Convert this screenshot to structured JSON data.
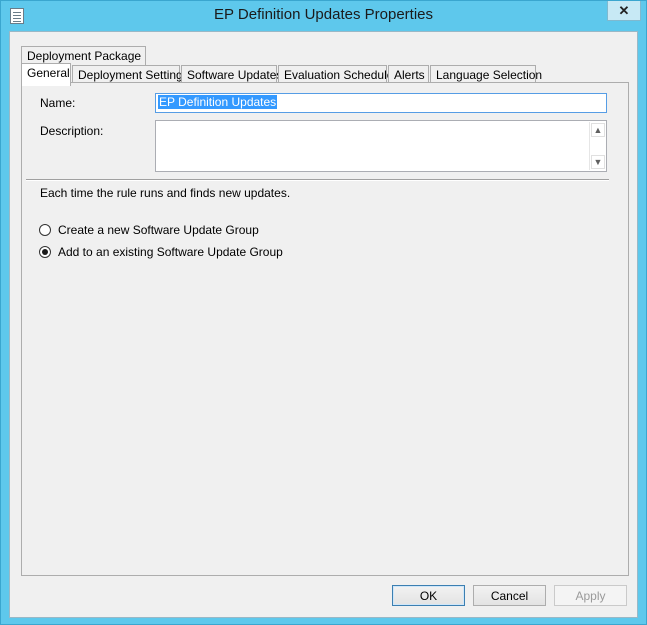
{
  "window": {
    "title": "EP Definition Updates Properties",
    "close_glyph": "✕"
  },
  "tabs_row1": [
    "Deployment Package"
  ],
  "tabs_row2": [
    "General",
    "Deployment Settings",
    "Software Updates",
    "Evaluation Schedule",
    "Alerts",
    "Language Selection"
  ],
  "selected_tab": "General",
  "general": {
    "name_label": "Name:",
    "name_value": "EP Definition Updates",
    "description_label": "Description:",
    "description_value": "",
    "rule_text": "Each time the rule runs and finds new updates.",
    "options": [
      {
        "label": "Create a new Software Update Group",
        "checked": false
      },
      {
        "label": "Add to an existing Software Update Group",
        "checked": true
      }
    ]
  },
  "buttons": {
    "ok": "OK",
    "cancel": "Cancel",
    "apply": "Apply"
  },
  "icons": {
    "window_icon": "properties-sheet-icon",
    "scroll_up": "▲",
    "scroll_down": "▼"
  }
}
